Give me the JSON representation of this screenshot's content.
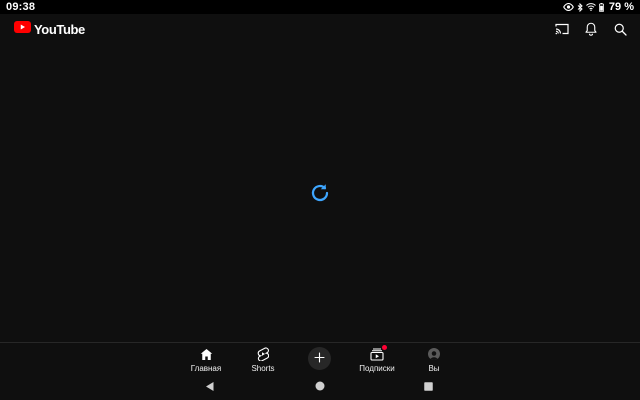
{
  "status_bar": {
    "time": "09:38",
    "battery_percent": "79 %"
  },
  "header": {
    "logo_text": "YouTube",
    "brand_color": "#ff0000",
    "actions": [
      "cast-icon",
      "bell-icon",
      "search-icon"
    ]
  },
  "content": {
    "spinner_color": "#3ea6ff",
    "state": "loading"
  },
  "bottom_nav": {
    "items": [
      {
        "label": "Главная",
        "icon": "home-icon",
        "active": true
      },
      {
        "label": "Shorts",
        "icon": "shorts-icon"
      },
      {
        "label": "",
        "icon": "plus-icon"
      },
      {
        "label": "Подписки",
        "icon": "subscriptions-icon",
        "badge": true
      },
      {
        "label": "Вы",
        "icon": "avatar"
      }
    ],
    "badge_color": "#ff0033"
  },
  "system_nav": {
    "buttons": [
      "back-icon",
      "home-circle-icon",
      "recents-icon"
    ]
  }
}
